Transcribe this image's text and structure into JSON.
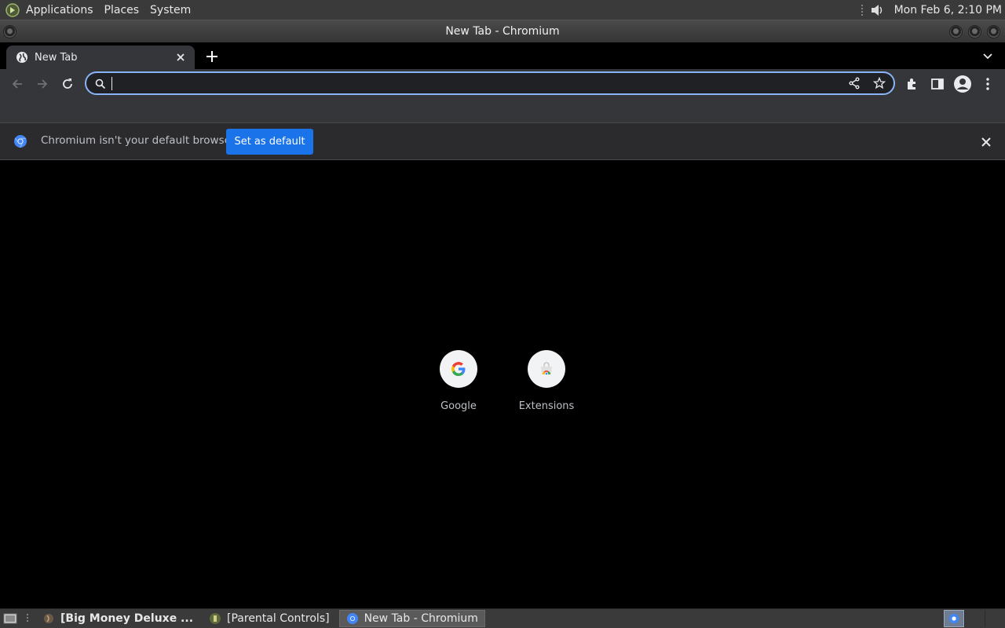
{
  "top_panel": {
    "menus": [
      "Applications",
      "Places",
      "System"
    ],
    "clock": "Mon Feb  6,  2:10 PM"
  },
  "window": {
    "title": "New Tab - Chromium"
  },
  "tabs": [
    {
      "title": "New Tab"
    }
  ],
  "omnibox": {
    "value": "",
    "placeholder": ""
  },
  "infobar": {
    "message": "Chromium isn't your default browser",
    "button_label": "Set as default"
  },
  "shortcuts": [
    {
      "label": "Google",
      "icon": "google-g-icon"
    },
    {
      "label": "Extensions",
      "icon": "chrome-web-store-icon"
    }
  ],
  "taskbar": [
    {
      "label": "[Big Money Deluxe ...",
      "bold": true
    },
    {
      "label": "[Parental Controls]",
      "bold": false
    },
    {
      "label": "New Tab - Chromium",
      "active": true
    }
  ],
  "colors": {
    "accent": "#8ab4f8",
    "button_blue": "#1a73e8",
    "toolbar": "#35363a",
    "panel": "#3a3a3a"
  }
}
